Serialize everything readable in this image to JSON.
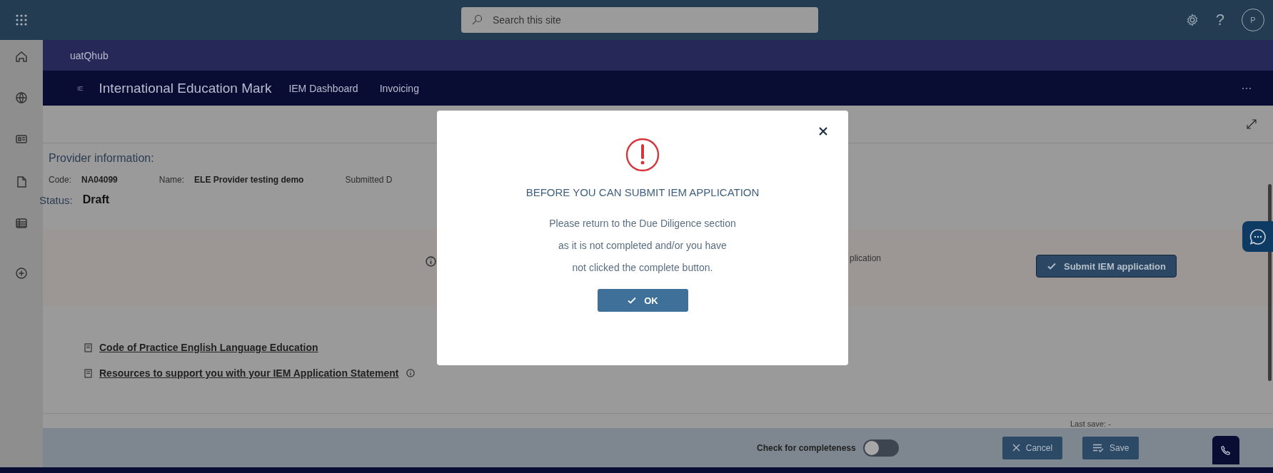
{
  "top_bar": {
    "search": {
      "placeholder": "Search this site"
    },
    "help": "?",
    "avatar": "P"
  },
  "site_bar": {
    "title": "uatQhub"
  },
  "nav_bar": {
    "logo": "IE",
    "title": "International Education Mark",
    "links": [
      "IEM Dashboard",
      "Invoicing"
    ]
  },
  "provider": {
    "heading": "Provider information:",
    "fields": [
      {
        "label": "Code:",
        "value": "NA04099"
      },
      {
        "label": "Name:",
        "value": "ELE Provider testing demo"
      },
      {
        "label": "Submitted D"
      }
    ],
    "status_label": "Status:",
    "status": "Draft"
  },
  "submit_band": {
    "partial_text": "plication",
    "button": "Submit IEM application"
  },
  "links": [
    {
      "text": "Code of Practice English Language Education",
      "info": false
    },
    {
      "text": "Resources to support you with your IEM Application Statement",
      "info": true
    }
  ],
  "last_save": "Last save: -",
  "footer": {
    "toggle": {
      "label": "Check for completeness",
      "on": false
    },
    "buttons": [
      {
        "label": "Cancel",
        "kind": "cancel"
      },
      {
        "label": "Save",
        "kind": "save"
      }
    ]
  },
  "dialog": {
    "title": "BEFORE YOU CAN SUBMIT IEM APPLICATION",
    "lines": [
      "Please return to the Due Diligence section",
      "as it is not completed and/or you have",
      "not clicked the complete button."
    ],
    "button": "OK"
  }
}
